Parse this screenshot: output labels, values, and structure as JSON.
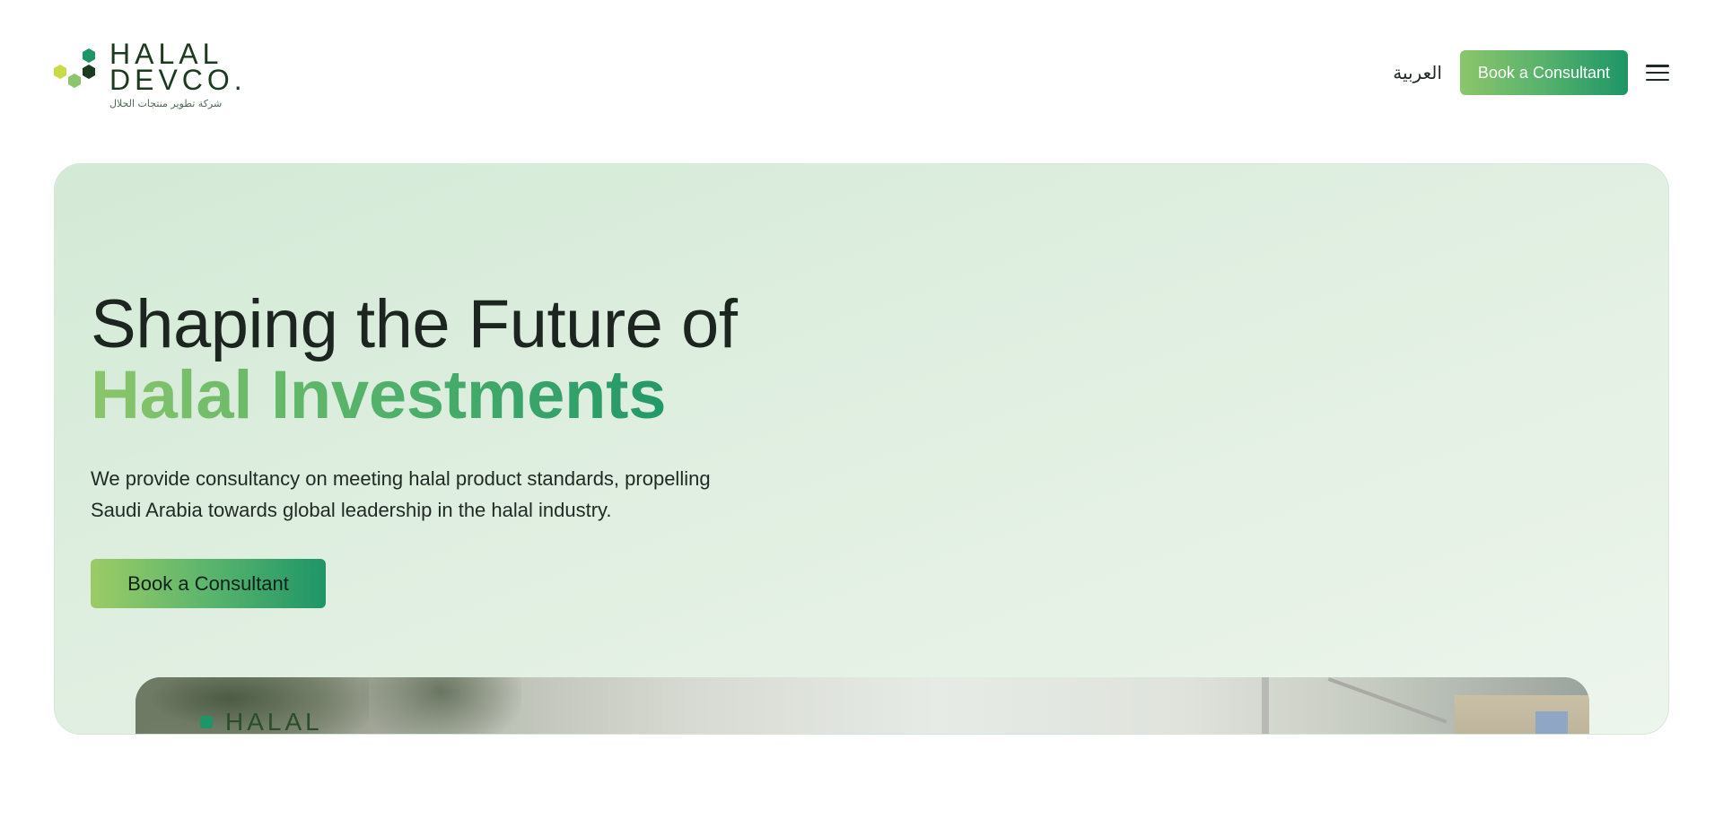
{
  "header": {
    "logo": {
      "line1": "HALAL",
      "line2": "DEVCO.",
      "subtitle_ar": "شركة تطوير منتجات الحلال",
      "hex_colors": [
        "#1e9567",
        "#1c3a1f",
        "#c9d94a",
        "#8cc56b"
      ]
    },
    "language_link": "العربية",
    "book_button": "Book a Consultant",
    "menu_icon": "hamburger-menu-icon"
  },
  "hero": {
    "title_line1": "Shaping the Future of",
    "title_line2": "Halal Investments",
    "description": "We provide consultancy on meeting halal product standards, propelling Saudi Arabia towards global leadership in the halal industry.",
    "cta_button": "Book a Consultant",
    "media_logo_text": "HALAL"
  },
  "colors": {
    "accent_start": "#8cc56b",
    "accent_end": "#1e9567",
    "hero_bg": "#d3ead6",
    "text_dark": "#1f2a24"
  }
}
